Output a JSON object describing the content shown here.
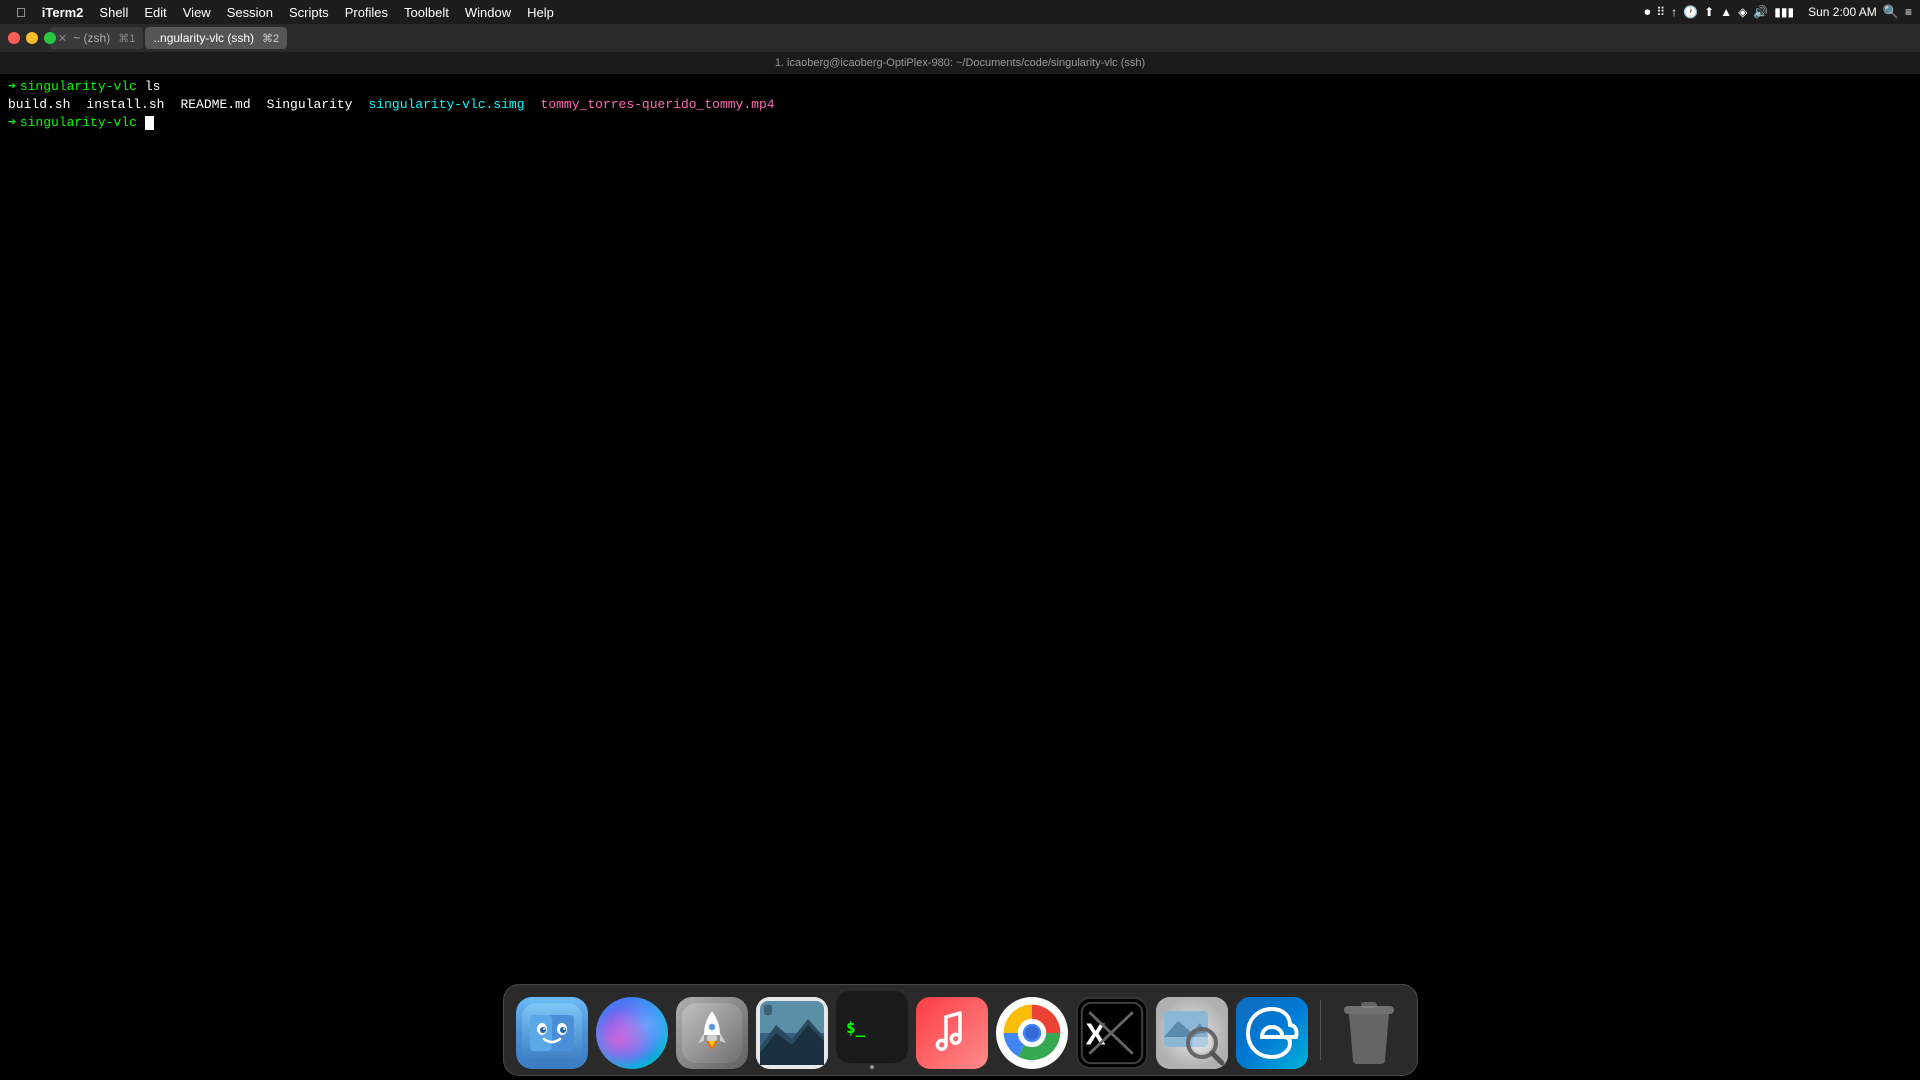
{
  "menubar": {
    "apple": "⌘",
    "app_name": "iTerm2",
    "menus": [
      "iTerm2",
      "Shell",
      "Edit",
      "View",
      "Session",
      "Scripts",
      "Profiles",
      "Toolbelt",
      "Window",
      "Help"
    ],
    "clock": "Sun 2:00 AM",
    "title": "1. icaoberg@icaoberg-OptiPlex-980: ~/Documents/code/singularity-vlc (ssh)"
  },
  "tabs": [
    {
      "id": "tab1",
      "label": "~ (zsh)",
      "shortcut": "⌘1",
      "active": false
    },
    {
      "id": "tab2",
      "label": "..ngularity-vlc (ssh)",
      "shortcut": "⌘2",
      "active": true
    }
  ],
  "terminal": {
    "lines": [
      {
        "type": "command",
        "prompt": "➜",
        "dir": "singularity-vlc",
        "cmd": "ls"
      },
      {
        "type": "output",
        "files": [
          {
            "name": "build.sh",
            "color": "white"
          },
          {
            "name": "install.sh",
            "color": "white"
          },
          {
            "name": "README.md",
            "color": "white"
          },
          {
            "name": "Singularity",
            "color": "white"
          },
          {
            "name": "singularity-vlc.simg",
            "color": "cyan"
          },
          {
            "name": "tommy_torres-querido_tommy.mp4",
            "color": "magenta"
          }
        ]
      },
      {
        "type": "prompt",
        "prompt": "➜",
        "dir": "singularity-vlc",
        "cmd": ""
      }
    ]
  },
  "dock": {
    "items": [
      {
        "id": "finder",
        "label": "Finder",
        "type": "finder",
        "has_dot": false
      },
      {
        "id": "siri",
        "label": "Siri",
        "type": "siri",
        "has_dot": false
      },
      {
        "id": "launchpad",
        "label": "Launchpad",
        "type": "rocket",
        "has_dot": false
      },
      {
        "id": "photos-browser",
        "label": "Photos Browser",
        "type": "photos",
        "has_dot": false
      },
      {
        "id": "terminal-app",
        "label": "Terminal",
        "type": "terminal",
        "has_dot": true
      },
      {
        "id": "music",
        "label": "Music",
        "type": "music",
        "has_dot": false
      },
      {
        "id": "chrome",
        "label": "Google Chrome",
        "type": "chrome",
        "has_dot": false
      },
      {
        "id": "x11",
        "label": "X11",
        "type": "x11",
        "has_dot": false
      },
      {
        "id": "image-capture",
        "label": "Image Capture",
        "type": "image-capture",
        "has_dot": false
      },
      {
        "id": "edge",
        "label": "Microsoft Edge",
        "type": "edge",
        "has_dot": false
      },
      {
        "id": "trash",
        "label": "Trash",
        "type": "trash",
        "has_dot": false
      }
    ]
  },
  "colors": {
    "terminal_bg": "#000000",
    "menubar_bg": "#1e1e1e",
    "tab_active": "#555555",
    "tab_inactive": "#3a3a3a",
    "prompt_green": "#00ff00",
    "file_cyan": "#00ffff",
    "file_magenta": "#ff69b4",
    "file_white": "#ffffff"
  }
}
